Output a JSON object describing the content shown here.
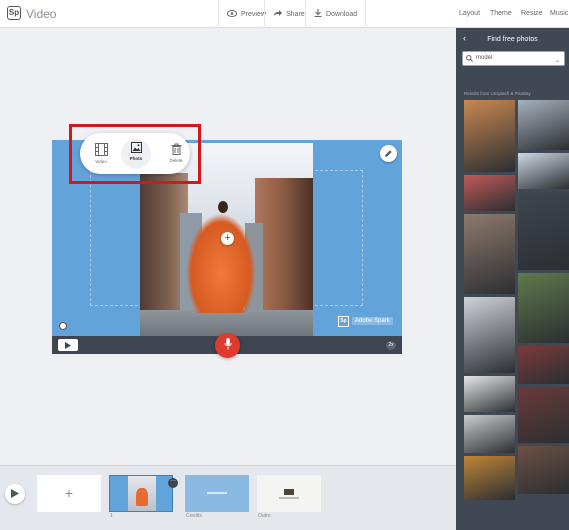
{
  "app": {
    "logo": "Sp",
    "title": "Video"
  },
  "toolbar": {
    "preview": "Preview",
    "share": "Share",
    "download": "Download",
    "menu": [
      "Layout",
      "Theme",
      "Resize",
      "Music"
    ]
  },
  "popup": {
    "video": "Video",
    "photo": "Photo",
    "delete": "Delete",
    "selected": "Photo"
  },
  "stage": {
    "watermark_logo": "Sp",
    "watermark_text": "Adobe Spark",
    "speed": "2x"
  },
  "timeline": {
    "add": "+",
    "slide_number": "1",
    "slides": [
      "Credits",
      "Outro"
    ]
  },
  "panel": {
    "title": "Find free photos",
    "search_value": "model",
    "results_label": "Results from Unsplash & Pixabay",
    "thumbs": [
      {
        "name": "photo-thumb",
        "color": "#c98750"
      },
      {
        "name": "photo-thumb",
        "color": "#a7b1bc"
      },
      {
        "name": "photo-thumb",
        "color": "#c15a56"
      },
      {
        "name": "photo-thumb",
        "color": "#cfd9e2"
      },
      {
        "name": "photo-thumb",
        "color": "#8e7a6d"
      },
      {
        "name": "photo-thumb",
        "color": "#3e4650"
      },
      {
        "name": "photo-thumb",
        "color": "#cfd3d8"
      },
      {
        "name": "photo-thumb",
        "color": "#5f7a4c"
      },
      {
        "name": "photo-thumb",
        "color": "#e7e7e7"
      },
      {
        "name": "photo-thumb",
        "color": "#7a3b3a"
      },
      {
        "name": "photo-thumb",
        "color": "#c9cdd0"
      },
      {
        "name": "photo-thumb",
        "color": "#6b3a38"
      },
      {
        "name": "photo-thumb",
        "color": "#c18536"
      },
      {
        "name": "photo-thumb",
        "color": "#6c5044"
      },
      {
        "name": "photo-thumb",
        "color": "#2c3138"
      },
      {
        "name": "photo-thumb",
        "color": "#d1c4ba"
      }
    ]
  },
  "colors": {
    "accent_blue": "#62a3da",
    "record_red": "#e03a2e",
    "panel_bg": "#3f4853",
    "highlight_red": "#d5161f"
  }
}
